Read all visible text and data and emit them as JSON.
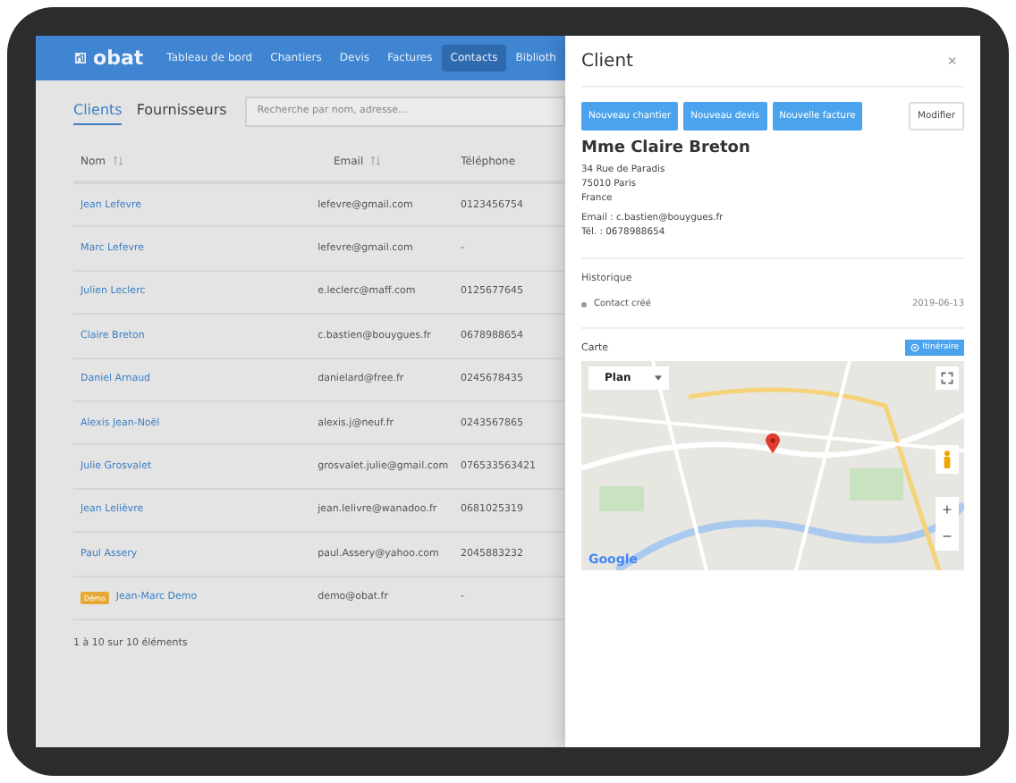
{
  "nav": {
    "brand": "obat",
    "items": [
      {
        "label": "Tableau de bord",
        "selected": false
      },
      {
        "label": "Chantiers",
        "selected": false
      },
      {
        "label": "Devis",
        "selected": false
      },
      {
        "label": "Factures",
        "selected": false
      },
      {
        "label": "Contacts",
        "selected": true
      },
      {
        "label": "Biblioth",
        "selected": false
      }
    ]
  },
  "tabs": [
    {
      "label": "Clients",
      "selected": true
    },
    {
      "label": "Fournisseurs",
      "selected": false
    }
  ],
  "search": {
    "placeholder": "Recherche par nom, adresse..."
  },
  "table": {
    "columns": [
      {
        "label": "Nom",
        "sortable": true
      },
      {
        "label": "Email",
        "sortable": true
      },
      {
        "label": "Téléphone",
        "sortable": false
      }
    ],
    "rows": [
      {
        "name": "Jean Lefevre",
        "email": "lefevre@gmail.com",
        "phone": "0123456754"
      },
      {
        "name": "Marc Lefevre",
        "email": "lefevre@gmail.com",
        "phone": "-"
      },
      {
        "name": "Julien Leclerc",
        "email": "e.leclerc@maff.com",
        "phone": "0125677645"
      },
      {
        "name": "Claire Breton",
        "email": "c.bastien@bouygues.fr",
        "phone": "0678988654"
      },
      {
        "name": "Daniel Arnaud",
        "email": "danielard@free.fr",
        "phone": "0245678435"
      },
      {
        "name": "Alexis Jean-Noël",
        "email": "alexis.j@neuf.fr",
        "phone": "0243567865"
      },
      {
        "name": "Julie Grosvalet",
        "email": "grosvalet.julie@gmail.com",
        "phone": "076533563421"
      },
      {
        "name": "Jean Lelièvre",
        "email": "jean.lelivre@wanadoo.fr",
        "phone": "0681025319"
      },
      {
        "name": "Paul Assery",
        "email": "paul.Assery@yahoo.com",
        "phone": "2045883232"
      },
      {
        "name": "Jean-Marc Demo",
        "badge": "Démo",
        "email": "demo@obat.fr",
        "phone": "-"
      }
    ],
    "footer": "1 à 10 sur 10 éléments"
  },
  "panel": {
    "title": "Client",
    "close": "×",
    "actions": [
      {
        "label": "Nouveau chantier",
        "kind": "primary"
      },
      {
        "label": "Nouveau devis",
        "kind": "primary"
      },
      {
        "label": "Nouvelle facture",
        "kind": "primary"
      },
      {
        "label": "Modifier",
        "kind": "secondary"
      }
    ],
    "name": "Mme Claire Breton",
    "address": [
      "34 Rue de Paradis",
      "75010 Paris",
      "France"
    ],
    "contact": [
      "Email : c.bastien@bouygues.fr",
      "Tél. : 0678988654"
    ],
    "history_title": "Historique",
    "history": [
      {
        "text": "Contact créé",
        "date": "2019-06-13"
      }
    ],
    "map_title": "Carte",
    "route_button": "Itinéraire",
    "map": {
      "type_selector": "Plan",
      "zoom_in": "+",
      "zoom_out": "−",
      "logo": "Google"
    }
  }
}
